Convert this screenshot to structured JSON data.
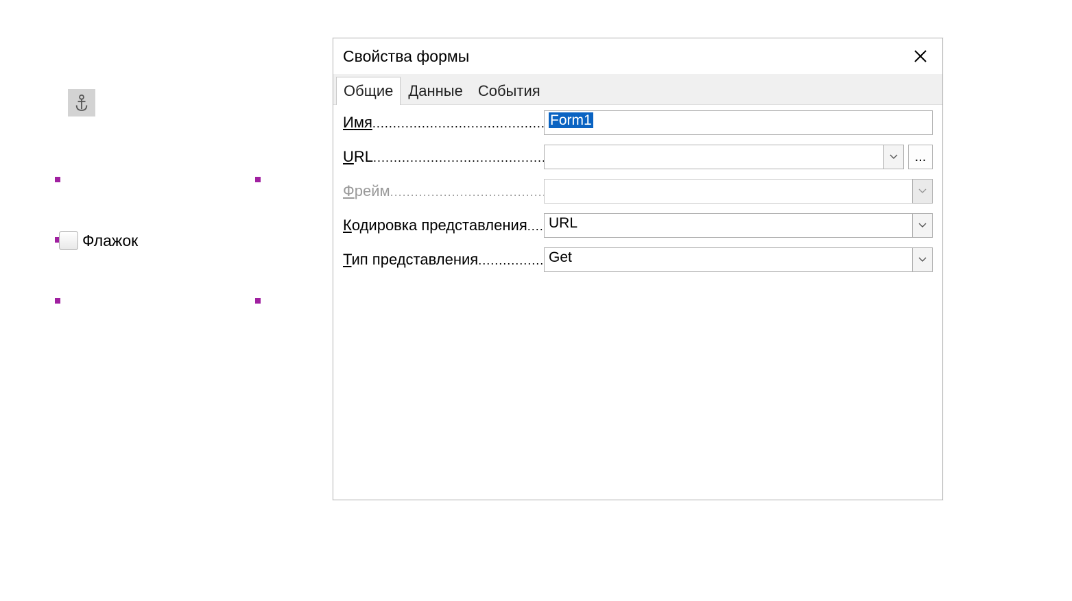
{
  "document": {
    "checkbox_label": "Флажок"
  },
  "dialog": {
    "title": "Свойства формы",
    "tabs": {
      "general": "Общие",
      "data": "Данные",
      "events": "События"
    },
    "fields": {
      "name": {
        "label": "Имя",
        "value": "Form1"
      },
      "url": {
        "label": "URL",
        "value": ""
      },
      "frame": {
        "label": "Фрейм",
        "value": ""
      },
      "encoding": {
        "label": "Кодировка представления",
        "value": "URL"
      },
      "submit_type": {
        "label": "Тип представления",
        "value": "Get"
      }
    },
    "ellipsis": "..."
  }
}
